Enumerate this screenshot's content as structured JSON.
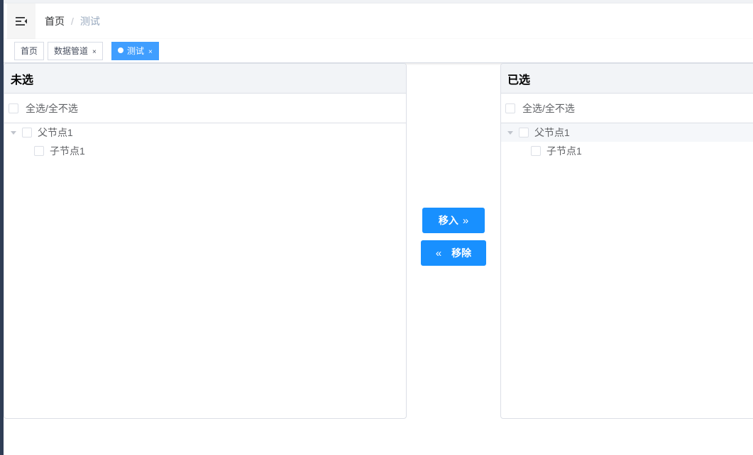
{
  "navbar": {
    "breadcrumb": {
      "home": "首页",
      "separator": "/",
      "current": "测试"
    },
    "menu_icon": "hamburger-fold-icon"
  },
  "tags": [
    {
      "label": "首页",
      "closable": false,
      "active": false
    },
    {
      "label": "数据管道",
      "closable": true,
      "active": false
    },
    {
      "label": "测试",
      "closable": true,
      "active": true
    }
  ],
  "tag_close_glyph": "×",
  "left_panel": {
    "title": "未选",
    "select_all": "全选/全不选",
    "tree": {
      "parent": "父节点1",
      "child": "子节点1"
    }
  },
  "right_panel": {
    "title": "已选",
    "select_all": "全选/全不选",
    "tree": {
      "parent": "父节点1",
      "child": "子节点1"
    }
  },
  "actions": {
    "move_in": "移入",
    "move_in_icon": "»",
    "remove": "移除",
    "remove_icon": "«"
  },
  "colors": {
    "primary": "#1890ff",
    "active_tag": "#409eff",
    "sidebar": "#2f3d55",
    "panel_header": "#f2f4f7"
  }
}
